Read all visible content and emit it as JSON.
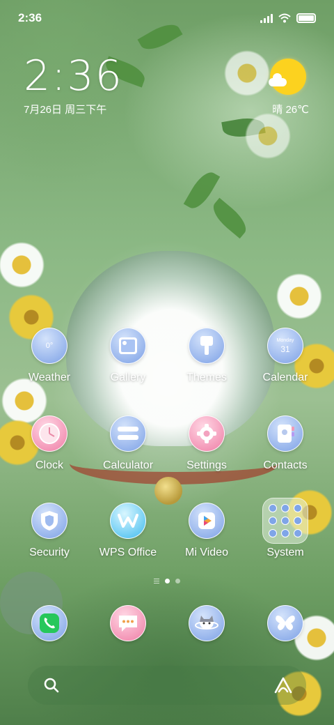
{
  "status_bar": {
    "time": "2:36",
    "icons": [
      "signal-icon",
      "wifi-icon",
      "battery-icon"
    ]
  },
  "clock_widget": {
    "time": "2:36",
    "date": "7月26日 周三下午"
  },
  "weather_widget": {
    "icon": "sunny-with-cloud",
    "text": "晴 26℃"
  },
  "apps": [
    {
      "label": "Weather",
      "icon": "weather-icon"
    },
    {
      "label": "Gallery",
      "icon": "gallery-icon"
    },
    {
      "label": "Themes",
      "icon": "themes-icon"
    },
    {
      "label": "Calendar",
      "icon": "calendar-icon",
      "month": "Monday",
      "day": "31"
    },
    {
      "label": "Clock",
      "icon": "clock-icon"
    },
    {
      "label": "Calculator",
      "icon": "calculator-icon"
    },
    {
      "label": "Settings",
      "icon": "settings-icon"
    },
    {
      "label": "Contacts",
      "icon": "contacts-icon"
    },
    {
      "label": "Security",
      "icon": "security-icon"
    },
    {
      "label": "WPS Office",
      "icon": "wps-icon"
    },
    {
      "label": "Mi Video",
      "icon": "mi-video-icon"
    },
    {
      "label": "System",
      "icon": "folder-icon"
    }
  ],
  "weather_app_badge": "0°",
  "page_indicator": {
    "pages": 2,
    "current": 1
  },
  "dock": [
    {
      "icon": "phone-icon"
    },
    {
      "icon": "messages-icon"
    },
    {
      "icon": "browser-icon"
    },
    {
      "icon": "butterfly-icon"
    }
  ],
  "search_bar": {
    "icons": [
      "search-icon",
      "assistant-icon"
    ]
  },
  "colors": {
    "icon_blue": "#8eaeea",
    "icon_pink": "#f28fb2",
    "sun": "#fcd21f",
    "phone_green": "#27c75b"
  }
}
